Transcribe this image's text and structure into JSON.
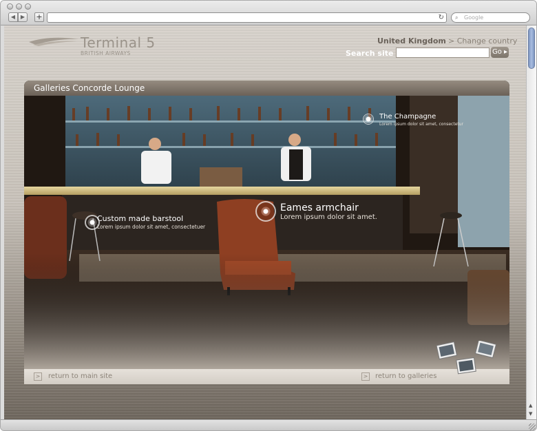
{
  "browser": {
    "url": "",
    "search_placeholder": "Google"
  },
  "site": {
    "brand": "Terminal 5",
    "brand_sub": "BRITISH AIRWAYS",
    "country": "United Kingdom",
    "change_country": "> Change country",
    "search_label": "Search site",
    "search_value": "",
    "go_label": "Go"
  },
  "gallery": {
    "title": "Galleries Concorde Lounge",
    "hotspots": [
      {
        "title": "The Champagne",
        "desc": "Lorem ipsum dolor sit amet, consectetur"
      },
      {
        "title": "Eames armchair",
        "desc": "Lorem ipsum dolor sit amet."
      },
      {
        "title": "Custom made barstool",
        "desc": "Lorem ipsum dolor sit amet, consectetuer"
      }
    ]
  },
  "footer": {
    "return_main": "return to main site",
    "return_galleries": "return to galleries",
    "arrow": ">"
  },
  "colors": {
    "accent": "#9a938a",
    "panel_bg": "#1d1712"
  }
}
